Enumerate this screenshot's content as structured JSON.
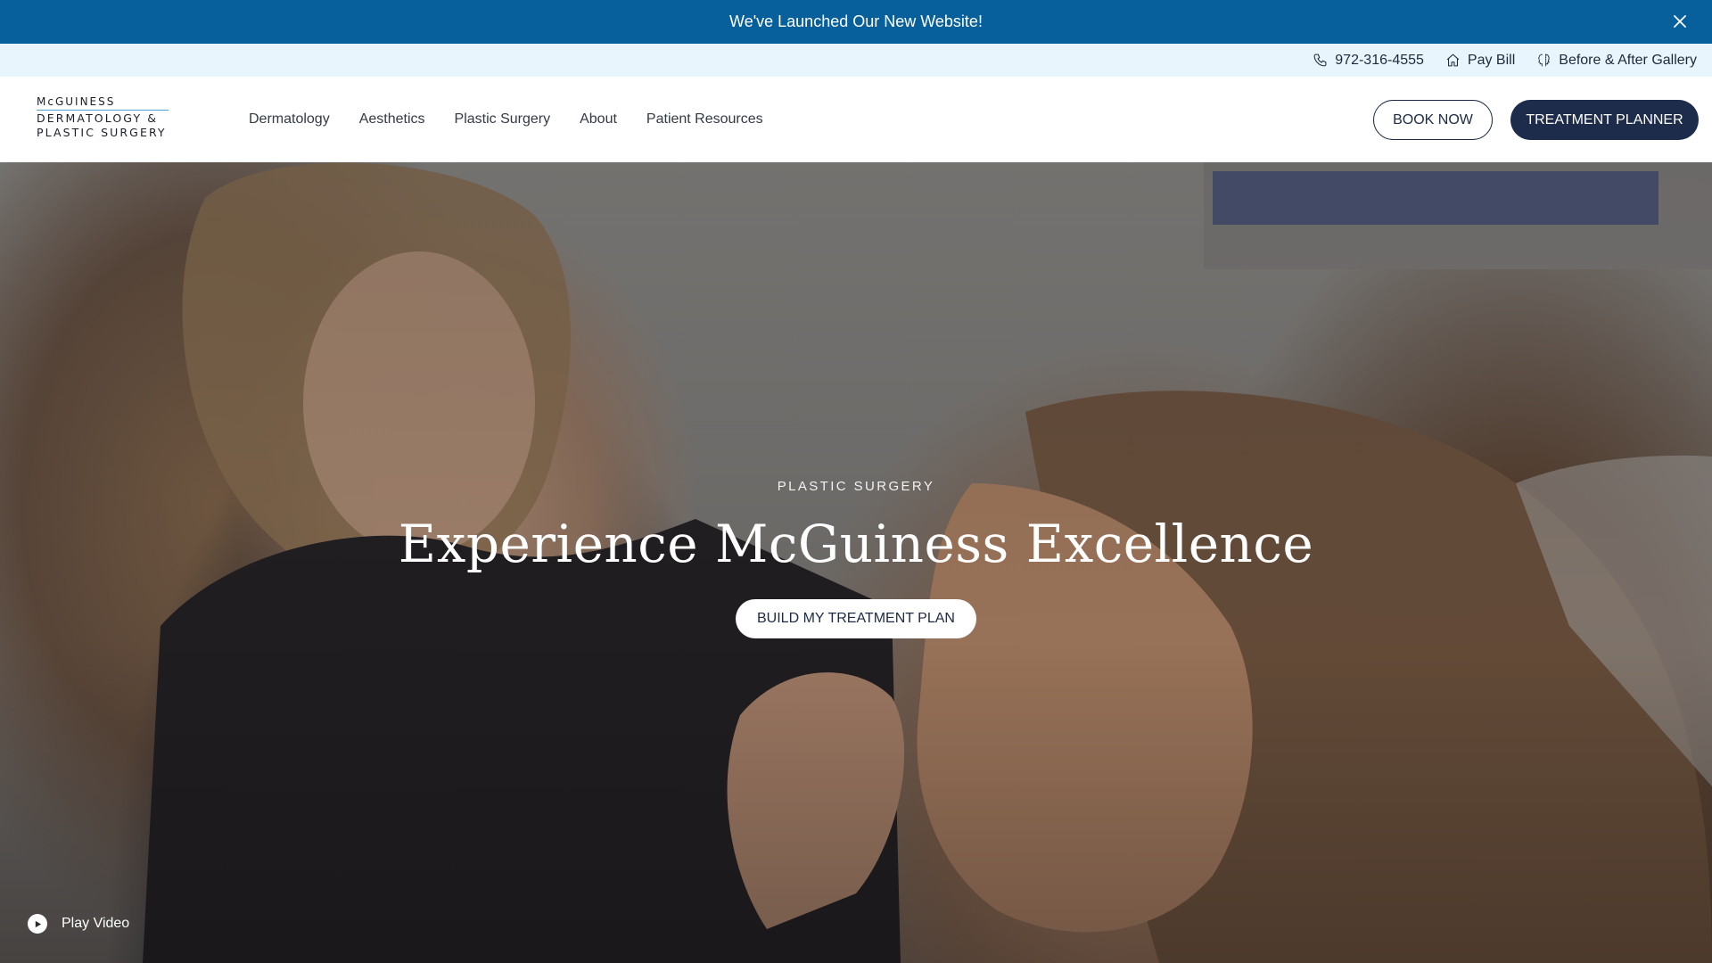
{
  "announcement": {
    "text": "We've Launched Our New Website!",
    "close_icon": "close-icon"
  },
  "utility": {
    "phone": "972-316-4555",
    "pay_bill": "Pay Bill",
    "gallery": "Before & After Gallery"
  },
  "brand": {
    "line1": "McGUINESS",
    "line2": "DERMATOLOGY &",
    "line3": "PLASTIC SURGERY"
  },
  "nav": {
    "items": [
      {
        "label": "Dermatology"
      },
      {
        "label": "Aesthetics"
      },
      {
        "label": "Plastic Surgery"
      },
      {
        "label": "About"
      },
      {
        "label": "Patient Resources"
      }
    ]
  },
  "header_actions": {
    "book_now": "BOOK NOW",
    "treatment_planner": "TREATMENT PLANNER"
  },
  "hero": {
    "eyebrow": "PLASTIC SURGERY",
    "title": "Experience McGuiness Excellence",
    "cta": "BUILD MY TREATMENT PLAN",
    "play_video": "Play Video"
  },
  "colors": {
    "announcement_bg": "#07609c",
    "utility_bg": "#e9f5fc",
    "navy": "#1d2c4b",
    "logo_rule": "#4aa1d6"
  }
}
